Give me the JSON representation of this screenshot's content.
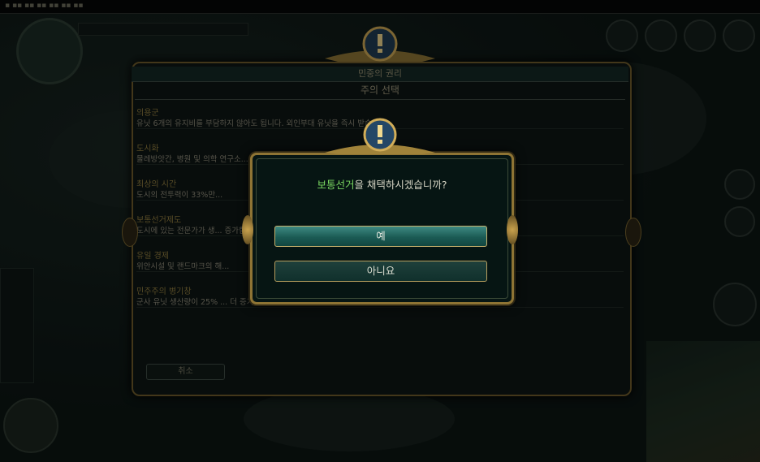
{
  "main_dialog": {
    "title": "민중의 권리",
    "subtitle": "주의 선택",
    "policies": [
      {
        "name": "의용군",
        "desc": "유닛 6개의 유지비를 부담하지 않아도 됩니다. 외인부대 유닛을 즉시 받습니다."
      },
      {
        "name": "도시화",
        "desc": "물레방앗간, 병원 및 의학 연구소..."
      },
      {
        "name": "최상의 시간",
        "desc": "도시의 전투력이 33%만..."
      },
      {
        "name": "보통선거제도",
        "desc": "도시에 있는 전문가가 생... 증가합니다."
      },
      {
        "name": "유일 경제",
        "desc": "위안시설 및 랜드마크의 해..."
      },
      {
        "name": "민주주의 병기창",
        "desc": "군사 유닛 생산량이 25% ... 더 증가합니다."
      }
    ],
    "cancel_label": "취소"
  },
  "confirm_popup": {
    "question_highlight": "보통선거",
    "question_rest": "을 채택하시겠습니까?",
    "yes_label": "예",
    "no_label": "아니요"
  },
  "icons": [
    "alert-icon",
    "popup-alert-icon"
  ],
  "colors": {
    "accent_gold": "#8e7434",
    "highlight_green": "#7ad861",
    "teal_button": "#1b5b54"
  }
}
